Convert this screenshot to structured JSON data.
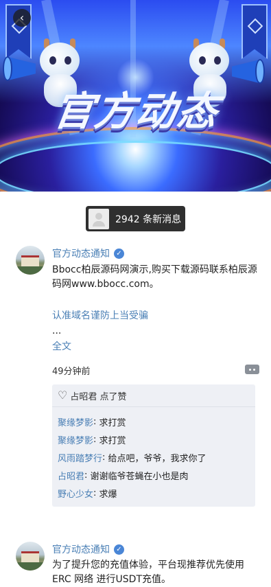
{
  "banner": {
    "title": "官方动态",
    "back_icon": "chevron-left-icon"
  },
  "notice": {
    "text": "2942 条新消息"
  },
  "posts": [
    {
      "author": "官方动态通知",
      "content": "Bbocc柏辰源码网演示,购买下载源码联系柏辰源码网www.bbocc.com。",
      "link": "认准域名谨防上当受骗",
      "ellipsis": "...",
      "full_text": "全文",
      "time": "49分钟前",
      "likes": "占昭君 点了赞",
      "comments": [
        {
          "user": "聚缘梦影",
          "text": "求打赏"
        },
        {
          "user": "聚缘梦影",
          "text": "求打赏"
        },
        {
          "user": "风雨踏梦行",
          "text": "给点吧，爷爷，我求你了"
        },
        {
          "user": "占昭君",
          "text": "谢谢临爷苍蝇在小也是肉"
        },
        {
          "user": "野心少女",
          "text": "求爆"
        }
      ]
    },
    {
      "author": "官方动态通知",
      "content": "为了提升您的充值体验，平台现推荐优先使用ERC 网络 进行USDT充值。"
    }
  ]
}
